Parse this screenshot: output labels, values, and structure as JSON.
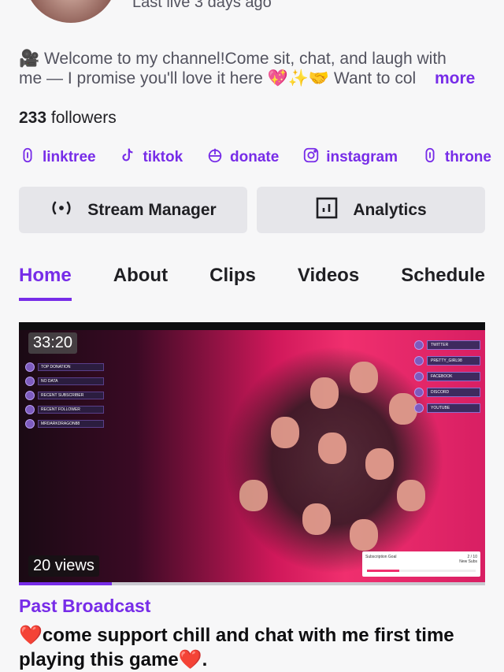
{
  "profile": {
    "last_live": "Last live 3 days ago",
    "bio_line1": "🎥 Welcome to my channel!Come sit, chat, and laugh with",
    "bio_line2": "me — I promise you'll love it here 💖✨🤝 Want to col",
    "more_label": "more",
    "followers_count": "233",
    "followers_label": "followers"
  },
  "links": [
    {
      "label": "linktree",
      "icon": "linktree-icon"
    },
    {
      "label": "tiktok",
      "icon": "tiktok-icon"
    },
    {
      "label": "donate",
      "icon": "donate-icon"
    },
    {
      "label": "instagram",
      "icon": "instagram-icon"
    },
    {
      "label": "throne",
      "icon": "throne-icon"
    }
  ],
  "actions": {
    "stream_manager": "Stream Manager",
    "analytics": "Analytics"
  },
  "tabs": [
    {
      "label": "Home",
      "active": true
    },
    {
      "label": "About",
      "active": false
    },
    {
      "label": "Clips",
      "active": false
    },
    {
      "label": "Videos",
      "active": false
    },
    {
      "label": "Schedule",
      "active": false
    }
  ],
  "video": {
    "duration": "33:20",
    "views": "20 views",
    "watched_fraction": 0.2,
    "category": "Past Broadcast",
    "title_line1": "come support chill and chat with me first time",
    "title_line2": "playing this game",
    "title_end": ".",
    "heart": "❤️",
    "overlay_left": [
      "TOP DONATION",
      "NO DATA",
      "RECENT SUBSCRIBER",
      "RECENT FOLLOWER",
      "MRDARKDRAGON88"
    ],
    "overlay_right": [
      "TWITTER",
      "PRETTY_GIRL98",
      "FACEBOOK",
      "DISCORD",
      "YOUTUBE"
    ],
    "subscription_card": "Subscription Goal",
    "subscription_count": "2 / 10",
    "subscription_note": "New Subs"
  },
  "colors": {
    "accent": "#772ce8",
    "background": "#f7f7f8",
    "button_bg": "#e6e6ea",
    "heart": "#d41a2a"
  }
}
